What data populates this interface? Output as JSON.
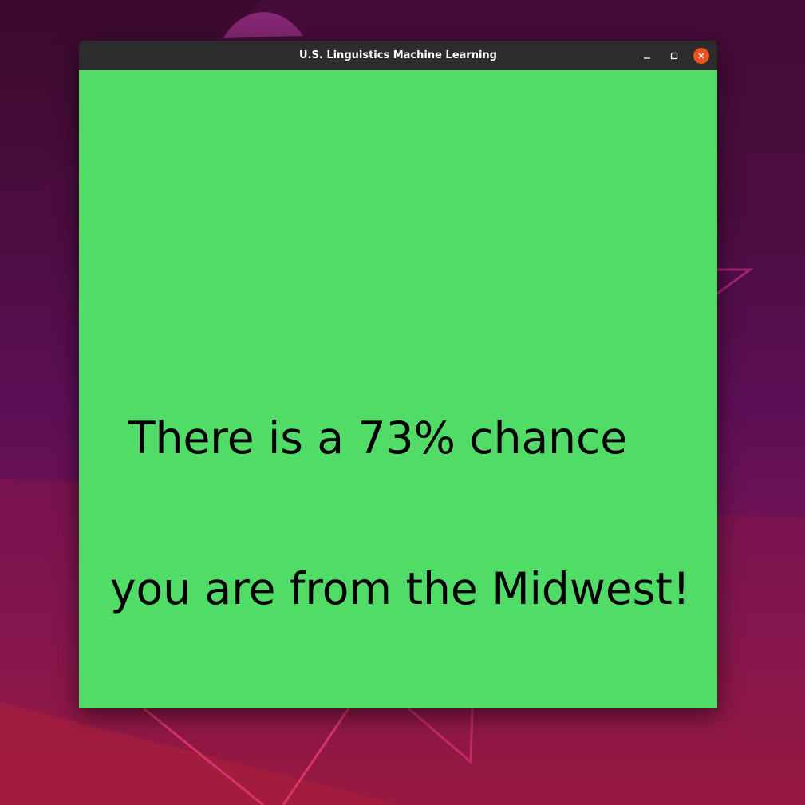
{
  "window": {
    "title": "U.S. Linguistics Machine Learning"
  },
  "controls": {
    "minimize_icon": "minimize-icon",
    "maximize_icon": "maximize-icon",
    "close_icon": "close-icon"
  },
  "result": {
    "line1": "There is a 73% chance",
    "line2": "you are from the Midwest!",
    "percent": 73,
    "background_color": "#50dc67"
  },
  "colors": {
    "titlebar": "#2c2c2c",
    "close_button": "#e95420"
  }
}
